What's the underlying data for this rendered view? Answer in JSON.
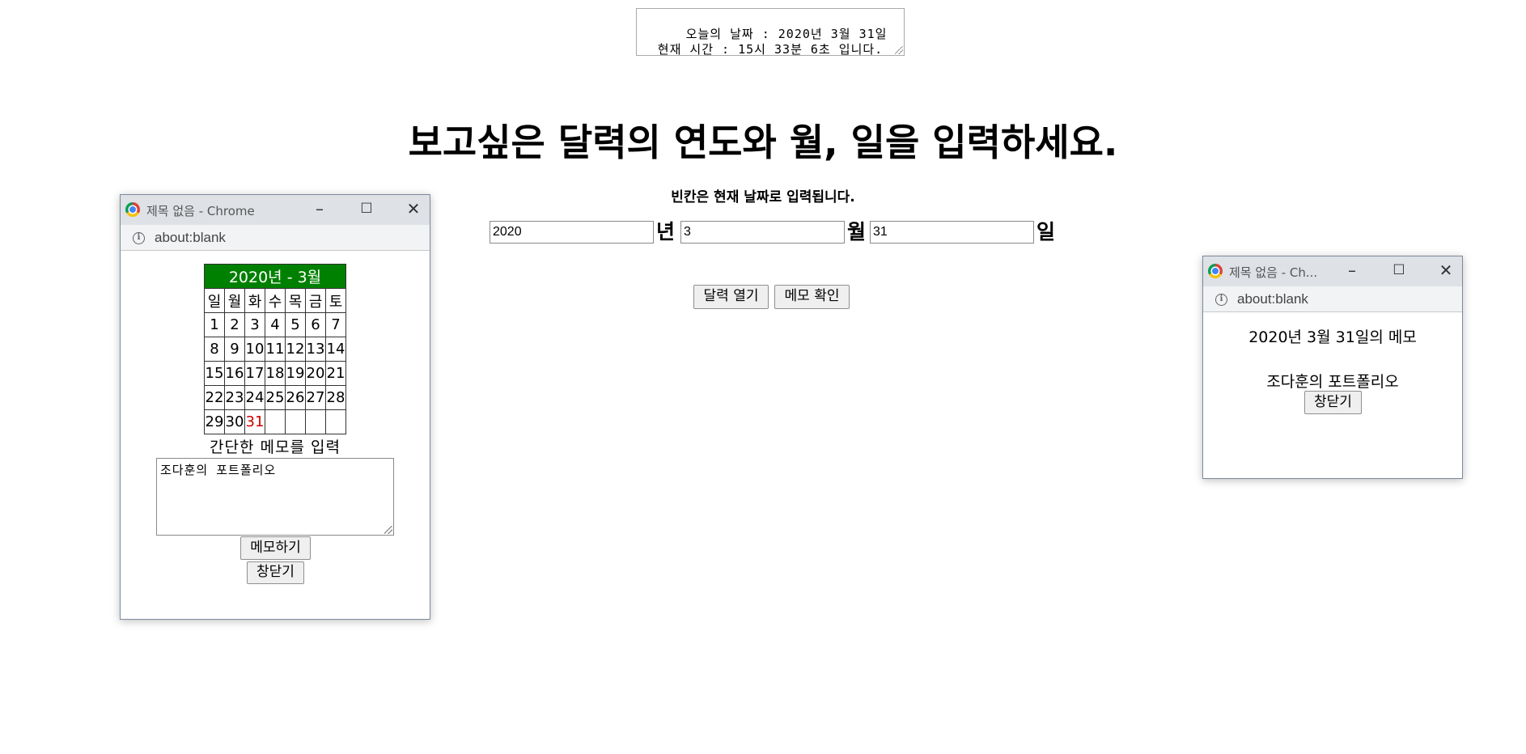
{
  "clock": {
    "text": "오늘의 날짜 : 2020년 3월 31일  현재 시간 : 15시 33분 6초 입니다."
  },
  "heading": "보고싶은 달력의 연도와 월, 일을 입력하세요.",
  "subtext": "빈칸은 현재 날짜로 입력됩니다.",
  "date_form": {
    "year_value": "2020",
    "year_unit": "년",
    "month_value": "3",
    "month_unit": "월",
    "day_value": "31",
    "day_unit": "일"
  },
  "buttons": {
    "open_calendar": "달력 열기",
    "check_memo": "메모 확인"
  },
  "calendar_popup": {
    "window_title": "제목 없음 - Chrome",
    "address": "about:blank",
    "calendar_header": "2020년 - 3월",
    "weekdays": [
      "일",
      "월",
      "화",
      "수",
      "목",
      "금",
      "토"
    ],
    "weeks": [
      [
        "1",
        "2",
        "3",
        "4",
        "5",
        "6",
        "7"
      ],
      [
        "8",
        "9",
        "10",
        "11",
        "12",
        "13",
        "14"
      ],
      [
        "15",
        "16",
        "17",
        "18",
        "19",
        "20",
        "21"
      ],
      [
        "22",
        "23",
        "24",
        "25",
        "26",
        "27",
        "28"
      ],
      [
        "29",
        "30",
        "31",
        "",
        "",
        "",
        ""
      ]
    ],
    "highlight_color": "#d00000",
    "header_color": "#008000",
    "memo_label": "간단한 메모를 입력",
    "memo_value": "조다훈의 포트폴리오",
    "save_button": "메모하기",
    "close_button": "창닫기"
  },
  "memo_popup": {
    "window_title": "제목 없음 - Ch...",
    "address": "about:blank",
    "memo_title": "2020년 3월 31일의 메모",
    "memo_content": "조다훈의 포트폴리오",
    "close_button": "창닫기"
  }
}
